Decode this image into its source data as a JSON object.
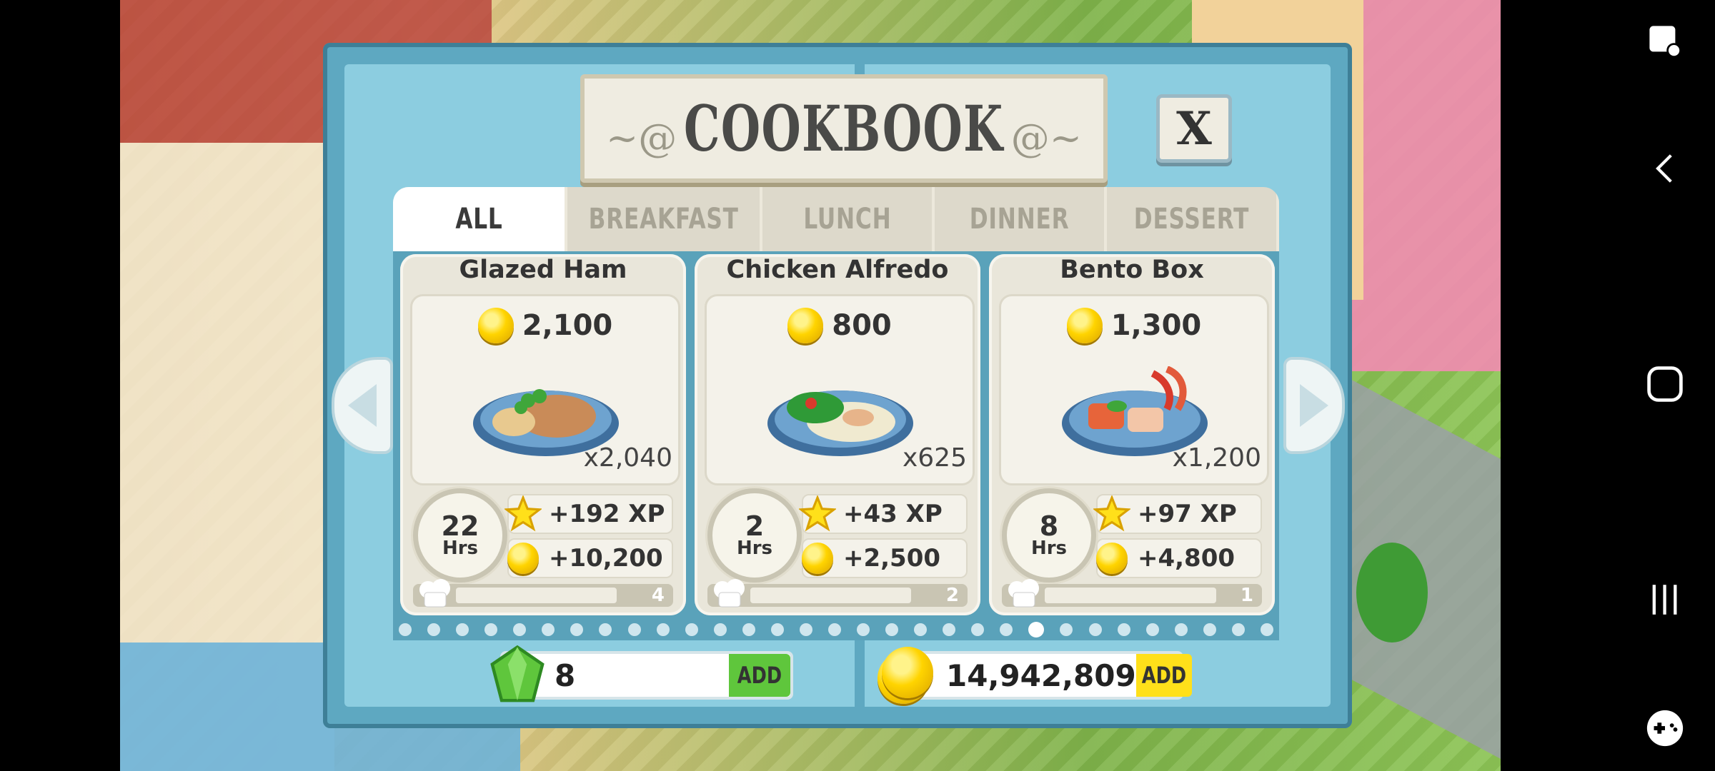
{
  "title": "COOKBOOK",
  "close_label": "X",
  "tabs": [
    {
      "label": "ALL",
      "active": true
    },
    {
      "label": "BREAKFAST",
      "active": false
    },
    {
      "label": "LUNCH",
      "active": false
    },
    {
      "label": "DINNER",
      "active": false
    },
    {
      "label": "DESSERT",
      "active": false
    }
  ],
  "recipes": [
    {
      "name": "Glazed Ham",
      "price": "2,100",
      "servings": "x2,040",
      "time": "22",
      "time_unit": "Hrs",
      "xp": "+192 XP",
      "coins": "+10,200",
      "progress_count": "4",
      "progress_fraction": 0.75,
      "dish_color": "#c98b58"
    },
    {
      "name": "Chicken Alfredo",
      "price": "800",
      "servings": "x625",
      "time": "2",
      "time_unit": "Hrs",
      "xp": "+43 XP",
      "coins": "+2,500",
      "progress_count": "2",
      "progress_fraction": 0.75,
      "dish_color": "#e9e1c0"
    },
    {
      "name": "Bento Box",
      "price": "1,300",
      "servings": "x1,200",
      "time": "8",
      "time_unit": "Hrs",
      "xp": "+97 XP",
      "coins": "+4,800",
      "progress_count": "1",
      "progress_fraction": 0.83,
      "dish_color": "#e7643a"
    }
  ],
  "pagination": {
    "total": 31,
    "active_index": 22
  },
  "currency": {
    "gems": "8",
    "gems_add_label": "ADD",
    "coins": "14,942,809",
    "coins_add_label": "ADD"
  },
  "colors": {
    "panel": "#5ea8c1",
    "panel_light": "#8ccde0",
    "gem_green": "#5fc63c",
    "coin_gold": "#ffd400",
    "add_green": "#5fc63c",
    "add_yellow": "#ffe01a"
  },
  "icons": [
    "coin-icon",
    "star-icon",
    "clock-icon",
    "chef-hat-icon",
    "gem-icon",
    "close-icon",
    "arrow-left-icon",
    "arrow-right-icon",
    "edit-icon",
    "back-icon",
    "home-icon",
    "recents-icon",
    "gamepad-icon"
  ]
}
